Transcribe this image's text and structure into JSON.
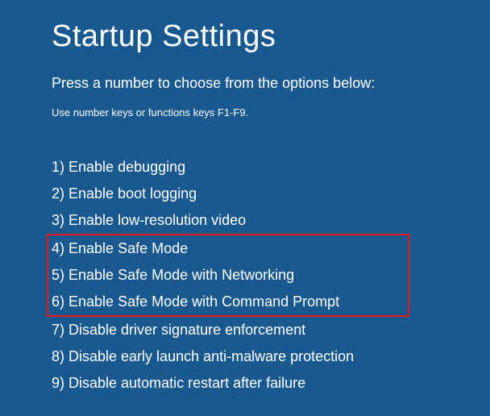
{
  "title": "Startup Settings",
  "subtitle": "Press a number to choose from the options below:",
  "hint": "Use number keys or functions keys F1-F9.",
  "options": [
    {
      "num": "1",
      "label": "Enable debugging"
    },
    {
      "num": "2",
      "label": "Enable boot logging"
    },
    {
      "num": "3",
      "label": "Enable low-resolution video"
    },
    {
      "num": "4",
      "label": "Enable Safe Mode"
    },
    {
      "num": "5",
      "label": "Enable Safe Mode with Networking"
    },
    {
      "num": "6",
      "label": "Enable Safe Mode with Command Prompt"
    },
    {
      "num": "7",
      "label": "Disable driver signature enforcement"
    },
    {
      "num": "8",
      "label": "Disable early launch anti-malware protection"
    },
    {
      "num": "9",
      "label": "Disable automatic restart after failure"
    }
  ],
  "highlight": {
    "color": "#e61717",
    "start_index": 3,
    "end_index": 5
  }
}
